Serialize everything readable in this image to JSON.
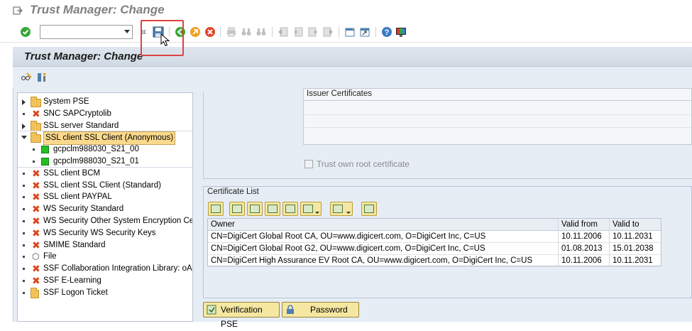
{
  "window": {
    "title": "Trust Manager: Change"
  },
  "toolbar": {
    "command_field_value": "",
    "back_glyph": "«"
  },
  "app": {
    "title": "Trust Manager: Change"
  },
  "tree": {
    "items": [
      {
        "label": "System PSE",
        "icon": "folder-icon",
        "node": "collapsed"
      },
      {
        "label": "SNC SAPCryptolib",
        "icon": "error-x-icon",
        "node": "leaf"
      },
      {
        "label": "SSL server Standard",
        "icon": "folder-icon",
        "node": "collapsed"
      },
      {
        "label": "SSL client SSL Client (Anonymous)",
        "icon": "folder-open-icon",
        "node": "expanded",
        "selected": true
      },
      {
        "label": "gcpclm988030_S21_00",
        "icon": "green-status-icon",
        "node": "child"
      },
      {
        "label": "gcpclm988030_S21_01",
        "icon": "green-status-icon",
        "node": "child"
      },
      {
        "label": "SSL client BCM",
        "icon": "error-x-icon",
        "node": "leaf"
      },
      {
        "label": "SSL client SSL Client (Standard)",
        "icon": "error-x-icon",
        "node": "leaf"
      },
      {
        "label": "SSL client PAYPAL",
        "icon": "error-x-icon",
        "node": "leaf"
      },
      {
        "label": "WS Security Standard",
        "icon": "error-x-icon",
        "node": "leaf"
      },
      {
        "label": "WS Security Other System Encryption Ce",
        "icon": "error-x-icon",
        "node": "leaf"
      },
      {
        "label": "WS Security WS Security Keys",
        "icon": "error-x-icon",
        "node": "leaf"
      },
      {
        "label": "SMIME Standard",
        "icon": "error-x-icon",
        "node": "leaf"
      },
      {
        "label": "File",
        "icon": "cube-icon",
        "node": "leaf"
      },
      {
        "label": "SSF Collaboration Integration Library: oAu",
        "icon": "error-x-icon",
        "node": "leaf"
      },
      {
        "label": "SSF E-Learning",
        "icon": "error-x-icon",
        "node": "leaf"
      },
      {
        "label": "SSF Logon Ticket",
        "icon": "folder-cert-icon",
        "node": "leaf"
      }
    ]
  },
  "issuer": {
    "header": "Issuer Certificates"
  },
  "trust_own_root": {
    "label": "Trust own root certificate",
    "checked": false
  },
  "cert_list": {
    "title": "Certificate List",
    "columns": [
      "Owner",
      "Valid from",
      "Valid to"
    ],
    "rows": [
      [
        "CN=DigiCert Global Root CA, OU=www.digicert.com, O=DigiCert Inc, C=US",
        "10.11.2006",
        "10.11.2031"
      ],
      [
        "CN=DigiCert Global Root G2, OU=www.digicert.com, O=DigiCert Inc, C=US",
        "01.08.2013",
        "15.01.2038"
      ],
      [
        "CN=DigiCert High Assurance EV Root CA, OU=www.digicert.com, O=DigiCert Inc, C=US",
        "10.11.2006",
        "10.11.2031"
      ]
    ]
  },
  "buttons": {
    "verification_pse": "Verification PSE",
    "password": "Password"
  },
  "colors": {
    "highlight_box": "#e0423e",
    "error_x": "#d9481e",
    "status_green": "#22c022",
    "selected_node": "#fbd98c",
    "button_face": "#f5e7a1"
  }
}
